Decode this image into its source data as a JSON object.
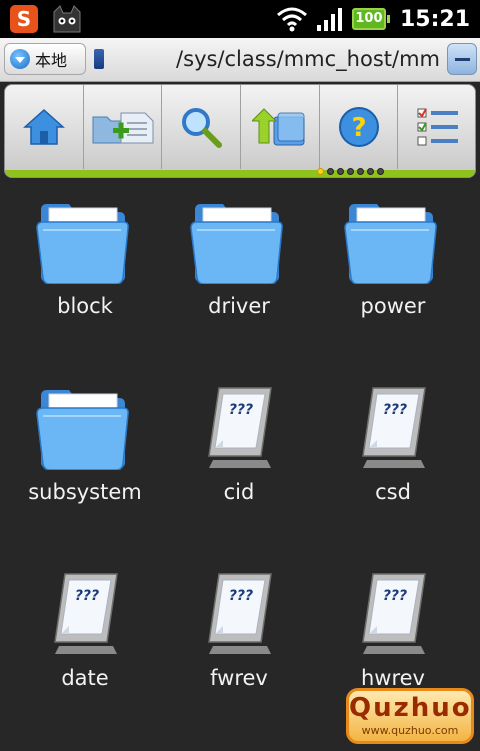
{
  "status_bar": {
    "battery_level": "100",
    "time": "15:21",
    "icons": [
      "sogou-input-icon",
      "cat-app-icon",
      "wifi-icon",
      "signal-icon",
      "battery-icon"
    ]
  },
  "path_bar": {
    "location_button_label": "本地",
    "path": "/sys/class/mmc_host/mm"
  },
  "toolbar": {
    "buttons": [
      {
        "name": "home",
        "icon": "home-icon"
      },
      {
        "name": "new-folder",
        "icon": "new-folder-icon"
      },
      {
        "name": "search",
        "icon": "search-icon"
      },
      {
        "name": "up",
        "icon": "up-folder-icon"
      },
      {
        "name": "help",
        "icon": "help-icon"
      },
      {
        "name": "view",
        "icon": "list-view-icon"
      }
    ],
    "page_count": 7,
    "active_page": 1
  },
  "files": [
    {
      "name": "block",
      "type": "folder"
    },
    {
      "name": "driver",
      "type": "folder"
    },
    {
      "name": "power",
      "type": "folder"
    },
    {
      "name": "subsystem",
      "type": "folder"
    },
    {
      "name": "cid",
      "type": "file",
      "badge": "???"
    },
    {
      "name": "csd",
      "type": "file",
      "badge": "???"
    },
    {
      "name": "date",
      "type": "file",
      "badge": "???"
    },
    {
      "name": "fwrev",
      "type": "file",
      "badge": "???"
    },
    {
      "name": "hwrev",
      "type": "file",
      "badge": "???"
    }
  ],
  "watermark": {
    "title": "Quzhuo",
    "url": "www.quzhuo.com"
  },
  "colors": {
    "background": "#272727",
    "accent_green": "#8fc21d",
    "folder_blue": "#5aa9ee"
  }
}
